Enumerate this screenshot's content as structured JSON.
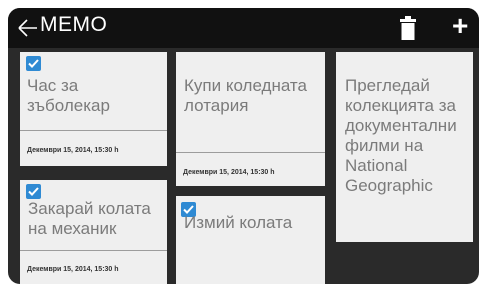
{
  "app": {
    "title": "MEMO"
  },
  "icons": {
    "back": "back-arrow-icon",
    "trash": "trash-icon",
    "add": "plus-icon"
  },
  "notes": [
    {
      "text": "Час за зъболекар",
      "date": "Декември 15, 2014, 15:30 h",
      "checked": true
    },
    {
      "text": "Купи коледната лотария",
      "date": "Декември 15, 2014, 15:30 h",
      "checked": false
    },
    {
      "text": "Прегледай колекцията за документални филми на National Geographic",
      "date": "",
      "checked": false
    },
    {
      "text": "Закарай колата на механик",
      "date": "Декември 15, 2014, 15:30 h",
      "checked": true
    },
    {
      "text": "Измий колата",
      "date": "",
      "checked": true
    }
  ],
  "colors": {
    "topbar": "#111111",
    "background": "#2a2a2a",
    "card": "#efefef",
    "checkbox": "#2f8ad3"
  }
}
